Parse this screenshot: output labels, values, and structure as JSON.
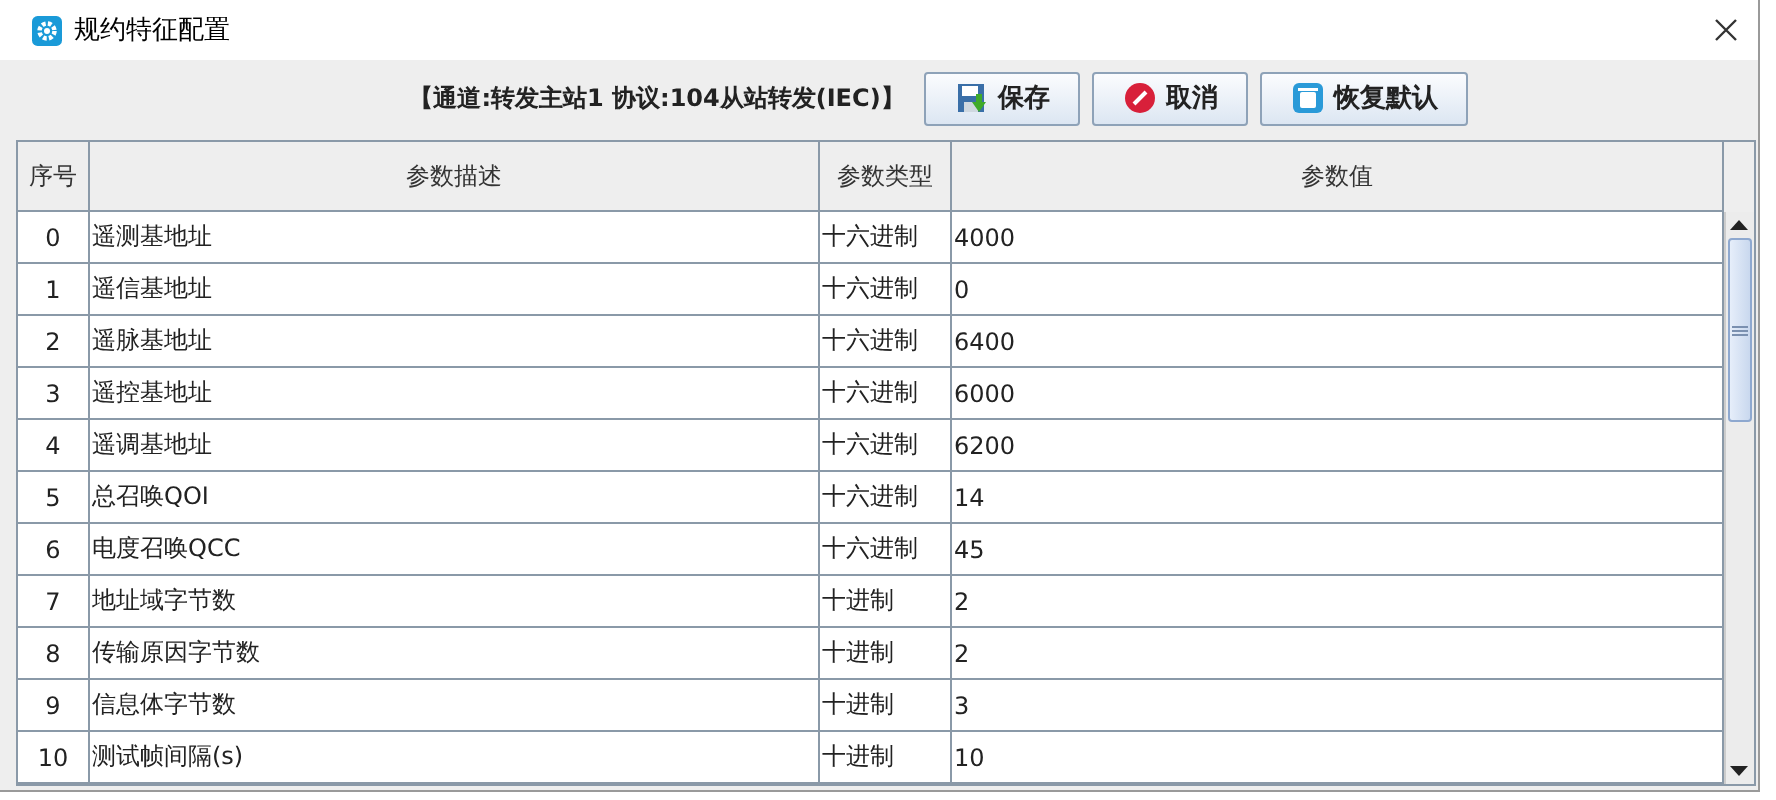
{
  "window": {
    "title": "规约特征配置"
  },
  "toolbar": {
    "info": "【通道:转发主站1  协议:104从站转发(IEC)】",
    "buttons": [
      {
        "kind": "save",
        "label": "保存"
      },
      {
        "kind": "cancel",
        "label": "取消"
      },
      {
        "kind": "reset",
        "label": "恢复默认"
      }
    ]
  },
  "table": {
    "columns": [
      "序号",
      "参数描述",
      "参数类型",
      "参数值"
    ],
    "rows": [
      [
        "0",
        "遥测基地址",
        "十六进制",
        "4000"
      ],
      [
        "1",
        "遥信基地址",
        "十六进制",
        "0"
      ],
      [
        "2",
        "遥脉基地址",
        "十六进制",
        "6400"
      ],
      [
        "3",
        "遥控基地址",
        "十六进制",
        "6000"
      ],
      [
        "4",
        "遥调基地址",
        "十六进制",
        "6200"
      ],
      [
        "5",
        "总召唤QOI",
        "十六进制",
        "14"
      ],
      [
        "6",
        "电度召唤QCC",
        "十六进制",
        "45"
      ],
      [
        "7",
        "地址域字节数",
        "十进制",
        "2"
      ],
      [
        "8",
        "传输原因字节数",
        "十进制",
        "2"
      ],
      [
        "9",
        "信息体字节数",
        "十进制",
        "3"
      ],
      [
        "10",
        "测试帧间隔(s)",
        "十进制",
        "10"
      ]
    ]
  }
}
